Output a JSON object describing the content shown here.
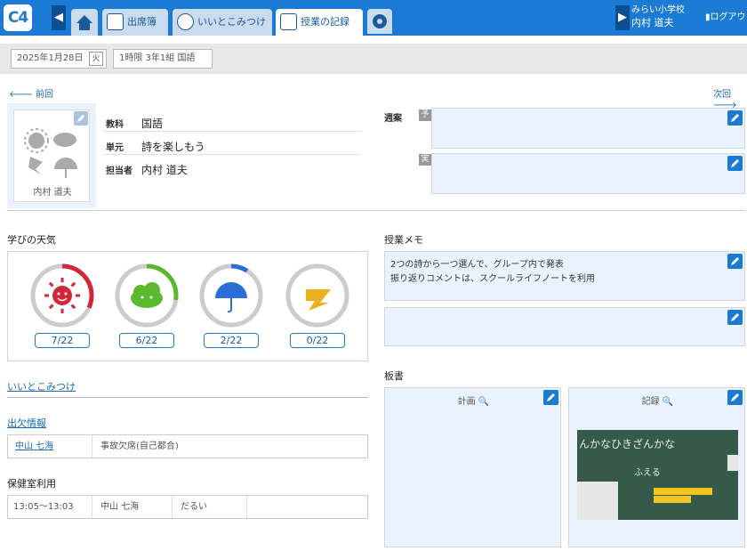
{
  "header": {
    "logo_text": "C4",
    "tabs": [
      {
        "label": "出席簿"
      },
      {
        "label": "いいとこみつけ"
      },
      {
        "label": "授業の記録"
      }
    ],
    "home_label": "ホーム",
    "school": "みらい小学校",
    "user": "内村 道夫",
    "logout": "ログアウト"
  },
  "subbar": {
    "date": "2025年1月28日",
    "weekday": "火",
    "period": "1時限 3年1組 国語"
  },
  "nav": {
    "prev": "前回",
    "next": "次回"
  },
  "lesson": {
    "teacher_photo_name": "内村 道夫",
    "subject_label": "教科",
    "subject": "国語",
    "unit_label": "単元",
    "unit": "詩を楽しもう",
    "teacher_label": "担当者",
    "teacher": "内村 道夫",
    "weekly_label": "週案",
    "plan_tag": "予",
    "actual_tag": "実"
  },
  "weather": {
    "title": "学びの天気",
    "items": [
      {
        "icon": "sun-icon",
        "count": "7/22",
        "color": "#d1273a",
        "ratio": 0.318
      },
      {
        "icon": "cloud-icon",
        "count": "6/22",
        "color": "#5cb82e",
        "ratio": 0.273
      },
      {
        "icon": "umbrella-icon",
        "count": "2/22",
        "color": "#2b6fd6",
        "ratio": 0.091
      },
      {
        "icon": "lightning-icon",
        "count": "0/22",
        "color": "#e9b21a",
        "ratio": 0.0
      }
    ]
  },
  "memo": {
    "title": "授業メモ",
    "lines": [
      "2つの詩から一つ選んで、グループ内で発表",
      "振り返りコメントは、スクールライフノートを利用"
    ]
  },
  "goodpoint": {
    "title": "いいとこみつけ"
  },
  "attendance": {
    "title": "出欠情報",
    "student": "中山 七海",
    "status": "事故欠席(自己都合)"
  },
  "infirmary": {
    "title": "保健室利用",
    "time": "13:05～13:03",
    "student": "中山 七海",
    "reason": "だるい"
  },
  "board": {
    "title": "板書",
    "plan_label": "計画",
    "record_label": "記録",
    "chalk_text1": "んかなひきざんかな",
    "chalk_text2": "ふえる"
  }
}
